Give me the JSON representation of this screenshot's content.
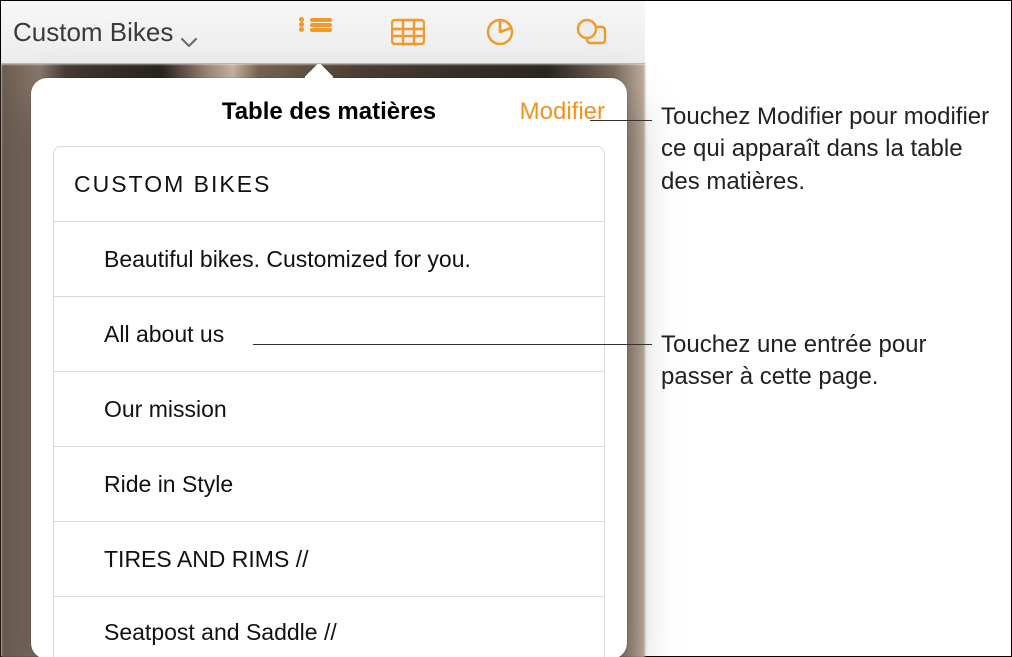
{
  "toolbar": {
    "doc_title": "Custom Bikes",
    "icons": {
      "toc": "list-icon",
      "table": "table-icon",
      "chart": "chart-icon",
      "shapes": "shapes-icon"
    }
  },
  "popover": {
    "title": "Table des matières",
    "edit_label": "Modifier",
    "entries": [
      {
        "text": "CUSTOM  BIKES",
        "level": 0
      },
      {
        "text": "Beautiful bikes. Customized for you.",
        "level": 1
      },
      {
        "text": "All about us",
        "level": 1
      },
      {
        "text": "Our mission",
        "level": 1
      },
      {
        "text": "Ride in Style",
        "level": 1
      },
      {
        "text": "TIRES AND RIMS //",
        "level": 1
      },
      {
        "text": "Seatpost and Saddle //",
        "level": 1
      }
    ]
  },
  "callouts": {
    "edit": "Touchez Modifier pour modifier ce qui apparaît dans la table des matières.",
    "entry": "Touchez une entrée pour passer à cette page."
  },
  "colors": {
    "accent": "#f0931f"
  }
}
